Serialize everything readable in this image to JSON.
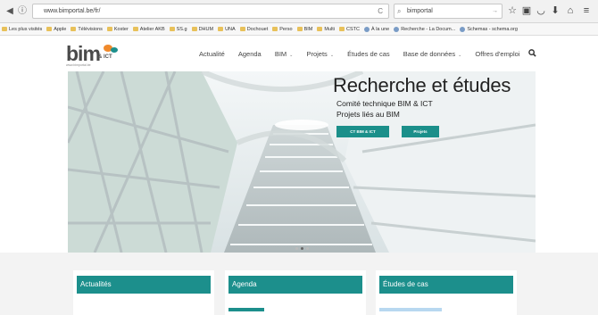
{
  "browser": {
    "url": "www.bimportal.be/fr/",
    "search_query": "bimportal",
    "bookmarks": [
      "Les plus visités",
      "Apple",
      "Télévisions",
      "Koster",
      "Atelier AKB",
      "SS.g",
      "DHUM",
      "UNA",
      "Dochouet",
      "Perso",
      "BIM",
      "Multi",
      "CSTC",
      "À la une",
      "Recherche - La Docum...",
      "Schemas - schema.org"
    ]
  },
  "site": {
    "logo_text": "bim",
    "logo_ict": "& ICT",
    "logo_sub": "www.bimportal.be",
    "nav": {
      "actualite": "Actualité",
      "agenda": "Agenda",
      "bim": "BIM",
      "projets": "Projets",
      "etudes": "Études de cas",
      "bases": "Base de données",
      "emploi": "Offres d'emploi"
    }
  },
  "hero": {
    "title": "Recherche et études",
    "subtitle1": "Comité technique BIM & ICT",
    "subtitle2": "Projets liés au BIM",
    "btn_ct": "CT BIM & ICT",
    "btn_proj": "Projets"
  },
  "cards": {
    "actualites": "Actualités",
    "agenda": "Agenda",
    "etudes": "Études de cas"
  },
  "colors": {
    "accent": "#1c8f8c",
    "logo_orange": "#f08a2c"
  }
}
